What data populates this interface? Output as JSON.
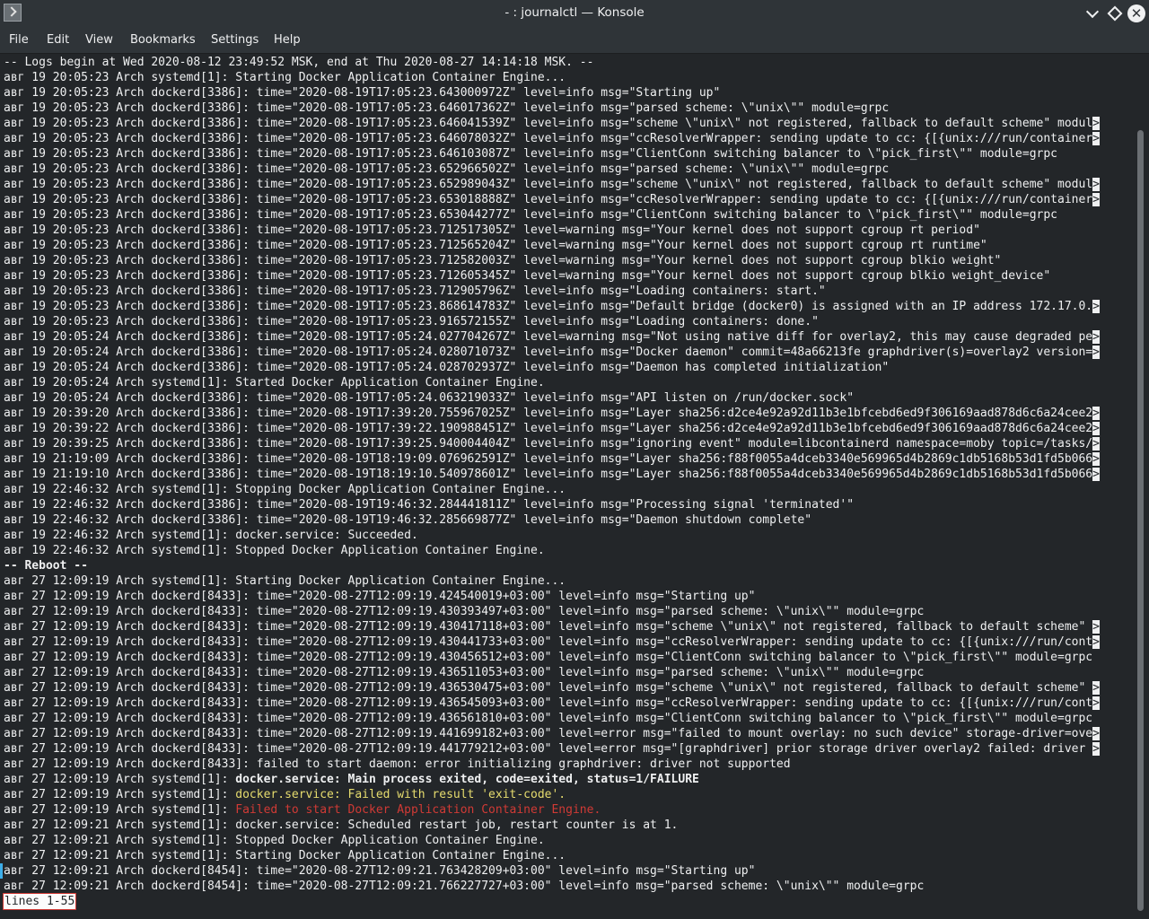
{
  "window": {
    "title": "- : journalctl — Konsole"
  },
  "menu": [
    "File",
    "Edit",
    "View",
    "Bookmarks",
    "Settings",
    "Help"
  ],
  "terminal": {
    "lines": [
      {
        "t": "-- Logs begin at Wed 2020-08-12 23:49:52 MSK, end at Thu 2020-08-27 14:14:18 MSK. --"
      },
      {
        "t": "авг 19 20:05:23 Arch systemd[1]: Starting Docker Application Container Engine..."
      },
      {
        "t": "авг 19 20:05:23 Arch dockerd[3386]: time=\"2020-08-19T17:05:23.643000972Z\" level=info msg=\"Starting up\""
      },
      {
        "t": "авг 19 20:05:23 Arch dockerd[3386]: time=\"2020-08-19T17:05:23.646017362Z\" level=info msg=\"parsed scheme: \\\"unix\\\"\" module=grpc"
      },
      {
        "t": "авг 19 20:05:23 Arch dockerd[3386]: time=\"2020-08-19T17:05:23.646041539Z\" level=info msg=\"scheme \\\"unix\\\" not registered, fallback to default scheme\" modul",
        "more": ">"
      },
      {
        "t": "авг 19 20:05:23 Arch dockerd[3386]: time=\"2020-08-19T17:05:23.646078032Z\" level=info msg=\"ccResolverWrapper: sending update to cc: {[{unix:///run/container",
        "more": ">"
      },
      {
        "t": "авг 19 20:05:23 Arch dockerd[3386]: time=\"2020-08-19T17:05:23.646103087Z\" level=info msg=\"ClientConn switching balancer to \\\"pick_first\\\"\" module=grpc"
      },
      {
        "t": "авг 19 20:05:23 Arch dockerd[3386]: time=\"2020-08-19T17:05:23.652966502Z\" level=info msg=\"parsed scheme: \\\"unix\\\"\" module=grpc"
      },
      {
        "t": "авг 19 20:05:23 Arch dockerd[3386]: time=\"2020-08-19T17:05:23.652989043Z\" level=info msg=\"scheme \\\"unix\\\" not registered, fallback to default scheme\" modul",
        "more": ">"
      },
      {
        "t": "авг 19 20:05:23 Arch dockerd[3386]: time=\"2020-08-19T17:05:23.653018888Z\" level=info msg=\"ccResolverWrapper: sending update to cc: {[{unix:///run/container",
        "more": ">"
      },
      {
        "t": "авг 19 20:05:23 Arch dockerd[3386]: time=\"2020-08-19T17:05:23.653044277Z\" level=info msg=\"ClientConn switching balancer to \\\"pick_first\\\"\" module=grpc"
      },
      {
        "t": "авг 19 20:05:23 Arch dockerd[3386]: time=\"2020-08-19T17:05:23.712517305Z\" level=warning msg=\"Your kernel does not support cgroup rt period\""
      },
      {
        "t": "авг 19 20:05:23 Arch dockerd[3386]: time=\"2020-08-19T17:05:23.712565204Z\" level=warning msg=\"Your kernel does not support cgroup rt runtime\""
      },
      {
        "t": "авг 19 20:05:23 Arch dockerd[3386]: time=\"2020-08-19T17:05:23.712582003Z\" level=warning msg=\"Your kernel does not support cgroup blkio weight\""
      },
      {
        "t": "авг 19 20:05:23 Arch dockerd[3386]: time=\"2020-08-19T17:05:23.712605345Z\" level=warning msg=\"Your kernel does not support cgroup blkio weight_device\""
      },
      {
        "t": "авг 19 20:05:23 Arch dockerd[3386]: time=\"2020-08-19T17:05:23.712905796Z\" level=info msg=\"Loading containers: start.\""
      },
      {
        "t": "авг 19 20:05:23 Arch dockerd[3386]: time=\"2020-08-19T17:05:23.868614783Z\" level=info msg=\"Default bridge (docker0) is assigned with an IP address 172.17.0.",
        "more": ">"
      },
      {
        "t": "авг 19 20:05:23 Arch dockerd[3386]: time=\"2020-08-19T17:05:23.916572155Z\" level=info msg=\"Loading containers: done.\""
      },
      {
        "t": "авг 19 20:05:24 Arch dockerd[3386]: time=\"2020-08-19T17:05:24.027704267Z\" level=warning msg=\"Not using native diff for overlay2, this may cause degraded pe",
        "more": ">"
      },
      {
        "t": "авг 19 20:05:24 Arch dockerd[3386]: time=\"2020-08-19T17:05:24.028071073Z\" level=info msg=\"Docker daemon\" commit=48a66213fe graphdriver(s)=overlay2 version=",
        "more": ">"
      },
      {
        "t": "авг 19 20:05:24 Arch dockerd[3386]: time=\"2020-08-19T17:05:24.028702937Z\" level=info msg=\"Daemon has completed initialization\""
      },
      {
        "t": "авг 19 20:05:24 Arch systemd[1]: Started Docker Application Container Engine."
      },
      {
        "t": "авг 19 20:05:24 Arch dockerd[3386]: time=\"2020-08-19T17:05:24.063219033Z\" level=info msg=\"API listen on /run/docker.sock\""
      },
      {
        "t": "авг 19 20:39:20 Arch dockerd[3386]: time=\"2020-08-19T17:39:20.755967025Z\" level=info msg=\"Layer sha256:d2ce4e92a92d11b3e1bfcebd6ed9f306169aad878d6c6a24cee2",
        "more": ">"
      },
      {
        "t": "авг 19 20:39:22 Arch dockerd[3386]: time=\"2020-08-19T17:39:22.190988451Z\" level=info msg=\"Layer sha256:d2ce4e92a92d11b3e1bfcebd6ed9f306169aad878d6c6a24cee2",
        "more": ">"
      },
      {
        "t": "авг 19 20:39:25 Arch dockerd[3386]: time=\"2020-08-19T17:39:25.940004404Z\" level=info msg=\"ignoring event\" module=libcontainerd namespace=moby topic=/tasks/",
        "more": ">"
      },
      {
        "t": "авг 19 21:19:09 Arch dockerd[3386]: time=\"2020-08-19T18:19:09.076962591Z\" level=info msg=\"Layer sha256:f88f0055a4dceb3340e569965d4b2869c1db5168b53d1fd5b066",
        "more": ">"
      },
      {
        "t": "авг 19 21:19:10 Arch dockerd[3386]: time=\"2020-08-19T18:19:10.540978601Z\" level=info msg=\"Layer sha256:f88f0055a4dceb3340e569965d4b2869c1db5168b53d1fd5b066",
        "more": ">"
      },
      {
        "t": "авг 19 22:46:32 Arch systemd[1]: Stopping Docker Application Container Engine..."
      },
      {
        "t": "авг 19 22:46:32 Arch dockerd[3386]: time=\"2020-08-19T19:46:32.284441811Z\" level=info msg=\"Processing signal 'terminated'\""
      },
      {
        "t": "авг 19 22:46:32 Arch dockerd[3386]: time=\"2020-08-19T19:46:32.285669877Z\" level=info msg=\"Daemon shutdown complete\""
      },
      {
        "t": "авг 19 22:46:32 Arch systemd[1]: docker.service: Succeeded."
      },
      {
        "t": "авг 19 22:46:32 Arch systemd[1]: Stopped Docker Application Container Engine."
      },
      {
        "t": "-- Reboot --",
        "style": "bold"
      },
      {
        "t": "авг 27 12:09:19 Arch systemd[1]: Starting Docker Application Container Engine..."
      },
      {
        "t": "авг 27 12:09:19 Arch dockerd[8433]: time=\"2020-08-27T12:09:19.424540019+03:00\" level=info msg=\"Starting up\""
      },
      {
        "t": "авг 27 12:09:19 Arch dockerd[8433]: time=\"2020-08-27T12:09:19.430393497+03:00\" level=info msg=\"parsed scheme: \\\"unix\\\"\" module=grpc"
      },
      {
        "t": "авг 27 12:09:19 Arch dockerd[8433]: time=\"2020-08-27T12:09:19.430417118+03:00\" level=info msg=\"scheme \\\"unix\\\" not registered, fallback to default scheme\" ",
        "more": ">"
      },
      {
        "t": "авг 27 12:09:19 Arch dockerd[8433]: time=\"2020-08-27T12:09:19.430441733+03:00\" level=info msg=\"ccResolverWrapper: sending update to cc: {[{unix:///run/cont",
        "more": ">"
      },
      {
        "t": "авг 27 12:09:19 Arch dockerd[8433]: time=\"2020-08-27T12:09:19.430456512+03:00\" level=info msg=\"ClientConn switching balancer to \\\"pick_first\\\"\" module=grpc"
      },
      {
        "t": "авг 27 12:09:19 Arch dockerd[8433]: time=\"2020-08-27T12:09:19.436511053+03:00\" level=info msg=\"parsed scheme: \\\"unix\\\"\" module=grpc"
      },
      {
        "t": "авг 27 12:09:19 Arch dockerd[8433]: time=\"2020-08-27T12:09:19.436530475+03:00\" level=info msg=\"scheme \\\"unix\\\" not registered, fallback to default scheme\" ",
        "more": ">"
      },
      {
        "t": "авг 27 12:09:19 Arch dockerd[8433]: time=\"2020-08-27T12:09:19.436545093+03:00\" level=info msg=\"ccResolverWrapper: sending update to cc: {[{unix:///run/cont",
        "more": ">"
      },
      {
        "t": "авг 27 12:09:19 Arch dockerd[8433]: time=\"2020-08-27T12:09:19.436561810+03:00\" level=info msg=\"ClientConn switching balancer to \\\"pick_first\\\"\" module=grpc"
      },
      {
        "t": "авг 27 12:09:19 Arch dockerd[8433]: time=\"2020-08-27T12:09:19.441699182+03:00\" level=error msg=\"failed to mount overlay: no such device\" storage-driver=ove",
        "more": ">"
      },
      {
        "t": "авг 27 12:09:19 Arch dockerd[8433]: time=\"2020-08-27T12:09:19.441779212+03:00\" level=error msg=\"[graphdriver] prior storage driver overlay2 failed: driver ",
        "more": ">"
      },
      {
        "t": "авг 27 12:09:19 Arch dockerd[8433]: failed to start daemon: error initializing graphdriver: driver not supported"
      },
      {
        "t": "авг 27 12:09:19 Arch systemd[1]: ",
        "hl": "docker.service: Main process exited, code=exited, status=1/FAILURE",
        "style": "bold"
      },
      {
        "t": "авг 27 12:09:19 Arch systemd[1]: ",
        "hl": "docker.service: Failed with result 'exit-code'.",
        "style": "yellow"
      },
      {
        "t": "авг 27 12:09:19 Arch systemd[1]: ",
        "hl": "Failed to start Docker Application Container Engine.",
        "style": "red"
      },
      {
        "t": "авг 27 12:09:21 Arch systemd[1]: docker.service: Scheduled restart job, restart counter is at 1."
      },
      {
        "t": "авг 27 12:09:21 Arch systemd[1]: Stopped Docker Application Container Engine."
      },
      {
        "t": "авг 27 12:09:21 Arch systemd[1]: Starting Docker Application Container Engine..."
      },
      {
        "t": "авг 27 12:09:21 Arch dockerd[8454]: time=\"2020-08-27T12:09:21.763428209+03:00\" level=info msg=\"Starting up\""
      },
      {
        "t": "авг 27 12:09:21 Arch dockerd[8454]: time=\"2020-08-27T12:09:21.766227727+03:00\" level=info msg=\"parsed scheme: \\\"unix\\\"\" module=grpc"
      }
    ],
    "status": "lines 1-55"
  }
}
